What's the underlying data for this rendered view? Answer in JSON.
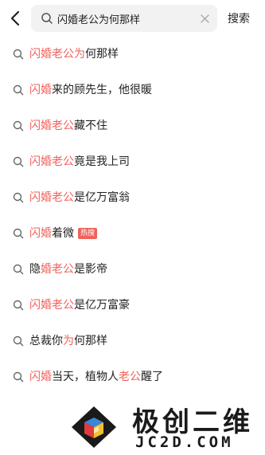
{
  "header": {
    "back_icon": "chevron-left-icon",
    "search_icon": "search-icon",
    "search_value": "闪婚老公为何那样",
    "clear_icon": "close-icon",
    "search_button_label": "搜索"
  },
  "colors": {
    "highlight": "#f2605a",
    "hot_badge_bg": "#f0625a",
    "search_bg": "#f2f2f2",
    "text": "#222222"
  },
  "suggestions": [
    {
      "parts": [
        {
          "t": "闪婚老公为",
          "hl": true
        },
        {
          "t": "何那样",
          "hl": false
        }
      ]
    },
    {
      "parts": [
        {
          "t": "闪婚",
          "hl": true
        },
        {
          "t": "来的顾先生，他很暖",
          "hl": false
        }
      ]
    },
    {
      "parts": [
        {
          "t": "闪婚老公",
          "hl": true
        },
        {
          "t": "藏不住",
          "hl": false
        }
      ]
    },
    {
      "parts": [
        {
          "t": "闪婚老公",
          "hl": true
        },
        {
          "t": "竟是我上司",
          "hl": false
        }
      ]
    },
    {
      "parts": [
        {
          "t": "闪婚老公",
          "hl": true
        },
        {
          "t": "是亿万富翁",
          "hl": false
        }
      ]
    },
    {
      "parts": [
        {
          "t": "闪婚",
          "hl": true
        },
        {
          "t": "着微",
          "hl": false
        }
      ],
      "badge": "热搜"
    },
    {
      "parts": [
        {
          "t": "隐",
          "hl": false
        },
        {
          "t": "婚老公",
          "hl": true
        },
        {
          "t": "是影帝",
          "hl": false
        }
      ]
    },
    {
      "parts": [
        {
          "t": "闪婚老公",
          "hl": true
        },
        {
          "t": "是亿万富豪",
          "hl": false
        }
      ]
    },
    {
      "parts": [
        {
          "t": "总裁你",
          "hl": false
        },
        {
          "t": "为",
          "hl": true
        },
        {
          "t": "何那样",
          "hl": false
        }
      ]
    },
    {
      "parts": [
        {
          "t": "闪婚",
          "hl": true
        },
        {
          "t": "当天，植物人",
          "hl": false
        },
        {
          "t": "老公",
          "hl": true
        },
        {
          "t": "醒了",
          "hl": false
        }
      ]
    }
  ],
  "watermark": {
    "title": "极创二维",
    "subtitle": "JC2D.COM",
    "logo_icon": "cube-logo-icon"
  }
}
